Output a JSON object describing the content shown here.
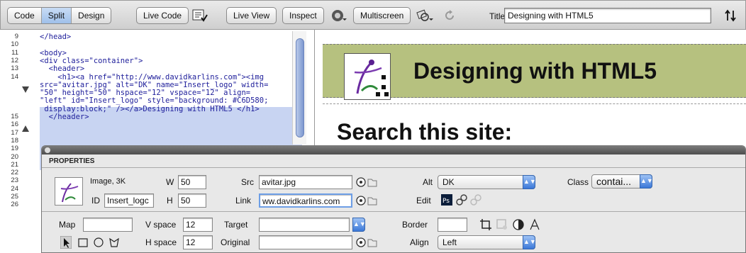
{
  "toolbar": {
    "views": [
      "Code",
      "Split",
      "Design"
    ],
    "active_view": "Split",
    "live_code": "Live Code",
    "live_view": "Live View",
    "inspect": "Inspect",
    "multiscreen": "Multiscreen",
    "title_label": "Title:",
    "title_value": "Designing with HTML5"
  },
  "code_view": {
    "lines": [
      {
        "n": "9",
        "text": "</head>"
      },
      {
        "n": "10",
        "text": ""
      },
      {
        "n": "11",
        "text": "<body>"
      },
      {
        "n": "12",
        "text": "<div class=\"container\">"
      },
      {
        "n": "13",
        "text": "  <header>"
      },
      {
        "n": "14",
        "text": "    <h1><a href=\"http://www.davidkarlins.com\"><img"
      },
      {
        "n": "",
        "text": "src=\"avitar.jpg\" alt=\"DK\" name=\"Insert_logo\" width="
      },
      {
        "n": "",
        "text": "\"50\" height=\"50\" hspace=\"12\" vspace=\"12\" align="
      },
      {
        "n": "",
        "text": "\"left\" id=\"Insert_logo\" style=\"background: #C6D580;"
      },
      {
        "n": "",
        "text": " display:block;\" /></a>Designing with HTML5 </h1>"
      },
      {
        "n": "15",
        "text": "  </header>"
      },
      {
        "n": "16",
        "text": ""
      },
      {
        "n": "17",
        "text": ""
      },
      {
        "n": "18",
        "text": ""
      },
      {
        "n": "19",
        "text": ""
      },
      {
        "n": "20",
        "text": ""
      },
      {
        "n": "21",
        "text": ""
      },
      {
        "n": "22",
        "text": ""
      },
      {
        "n": "23",
        "text": ""
      },
      {
        "n": "24",
        "text": ""
      },
      {
        "n": "25",
        "text": ""
      },
      {
        "n": "26",
        "text": ""
      }
    ]
  },
  "design_view": {
    "heading": "Designing with HTML5",
    "subheading": "Search this site:",
    "header_color": "#C6D580"
  },
  "properties": {
    "tab_label": "PROPERTIES",
    "image_info": "Image, 3K",
    "id_label": "ID",
    "id_value": "Insert_logc",
    "w_label": "W",
    "w_value": "50",
    "h_label": "H",
    "h_value": "50",
    "src_label": "Src",
    "src_value": "avitar.jpg",
    "link_label": "Link",
    "link_value": "ww.davidkarlins.com",
    "alt_label": "Alt",
    "alt_value": "DK",
    "edit_label": "Edit",
    "class_label": "Class",
    "class_value": "contai...",
    "map_label": "Map",
    "map_value": "",
    "vspace_label": "V space",
    "vspace_value": "12",
    "target_label": "Target",
    "target_value": "",
    "border_label": "Border",
    "border_value": "",
    "hspace_label": "H space",
    "hspace_value": "12",
    "original_label": "Original",
    "original_value": "",
    "align_label": "Align",
    "align_value": "Left"
  },
  "icons": [
    "multiscreen-preview-icon",
    "file-validation-icon",
    "browser-preview-icon",
    "refresh-icon",
    "title-sort-icon",
    "point-to-file-icon",
    "browse-folder-icon",
    "photoshop-edit-icon",
    "optimize-icon",
    "crop-icon",
    "resample-icon",
    "brightness-contrast-icon",
    "sharpen-icon",
    "pointer-hotspot-icon",
    "rect-hotspot-icon",
    "circle-hotspot-icon",
    "polygon-hotspot-icon"
  ]
}
